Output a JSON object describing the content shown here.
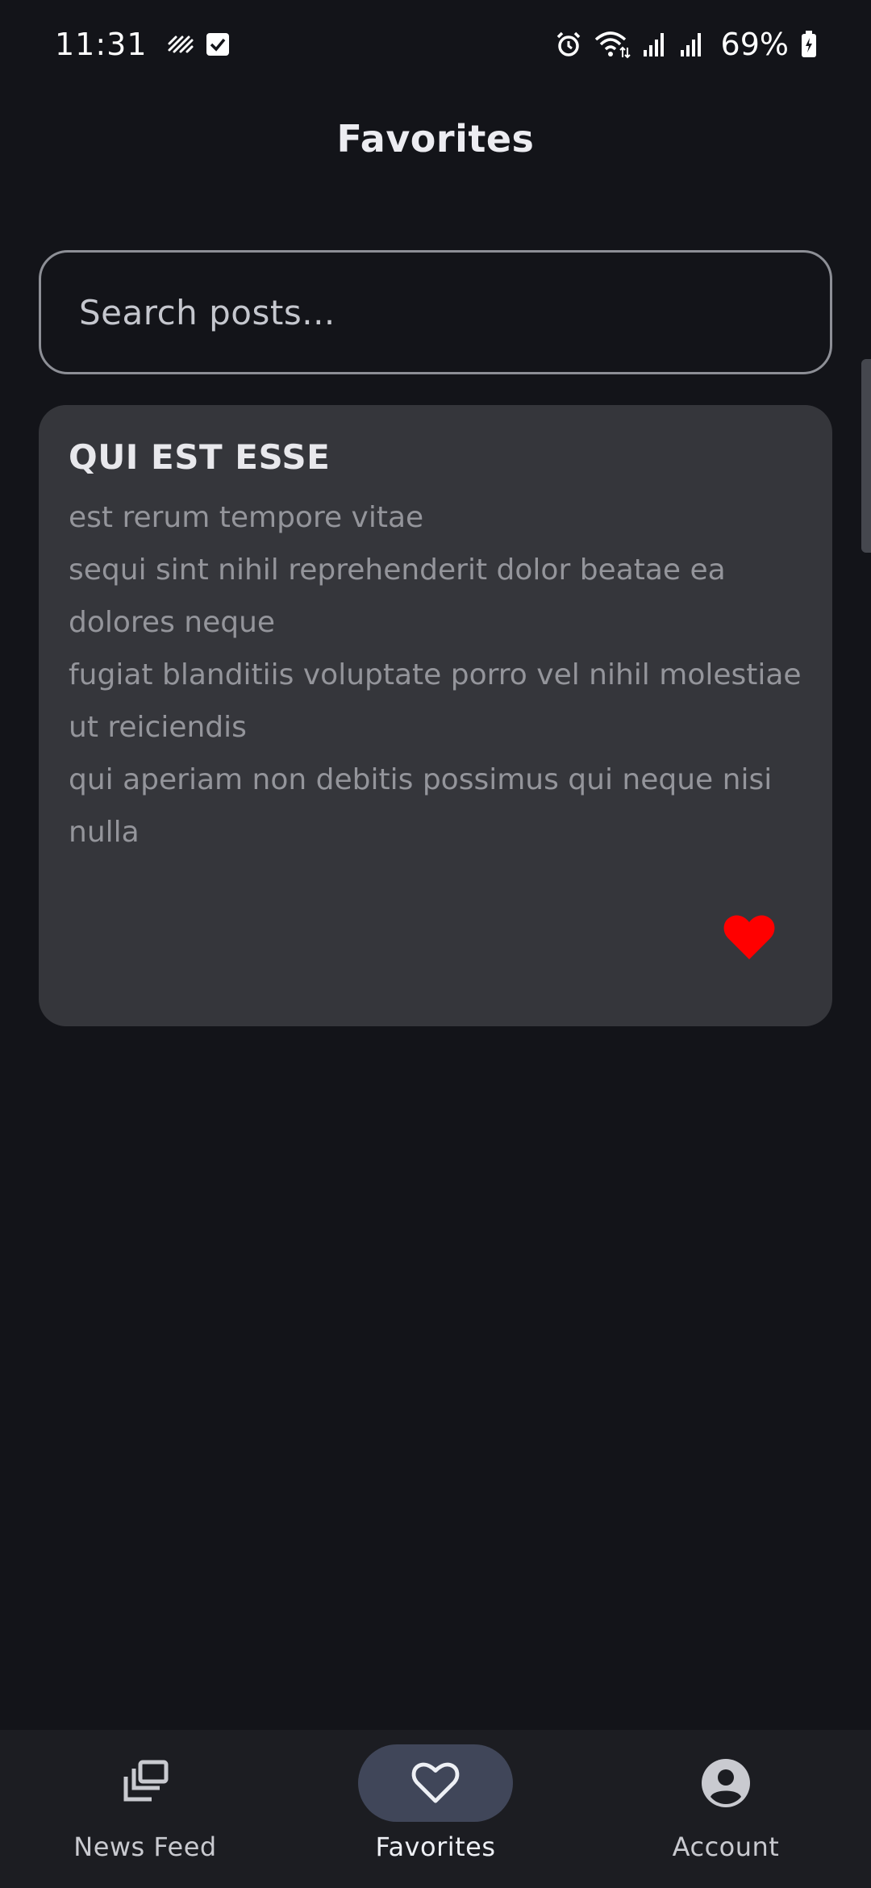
{
  "status_bar": {
    "time": "11:31",
    "battery": "69%",
    "left_icons": [
      "spark-icon",
      "checkbox-icon"
    ],
    "right_icons": [
      "alarm-icon",
      "wifi-icon",
      "signal-icon",
      "signal-icon",
      "battery-icon"
    ]
  },
  "header": {
    "title": "Favorites"
  },
  "search": {
    "placeholder": "Search posts..."
  },
  "posts": [
    {
      "title": "QUI EST ESSE",
      "body_lines": [
        "est rerum tempore vitae",
        "sequi sint nihil reprehenderit dolor beatae ea dolores neque",
        "fugiat blanditiis voluptate porro vel nihil molestiae ut reiciendis",
        "qui aperiam non debitis possimus qui neque nisi nulla"
      ],
      "favorited": true,
      "favorite_color": "#ff0000"
    }
  ],
  "bottom_nav": {
    "items": [
      {
        "label": "News Feed",
        "icon": "news-feed-icon",
        "active": false
      },
      {
        "label": "Favorites",
        "icon": "heart-icon",
        "active": true
      },
      {
        "label": "Account",
        "icon": "account-icon",
        "active": false
      }
    ],
    "active_indicator_color": "#404659"
  },
  "colors": {
    "background": "#131419",
    "card": "#35363b",
    "nav_background": "#1c1d22"
  }
}
